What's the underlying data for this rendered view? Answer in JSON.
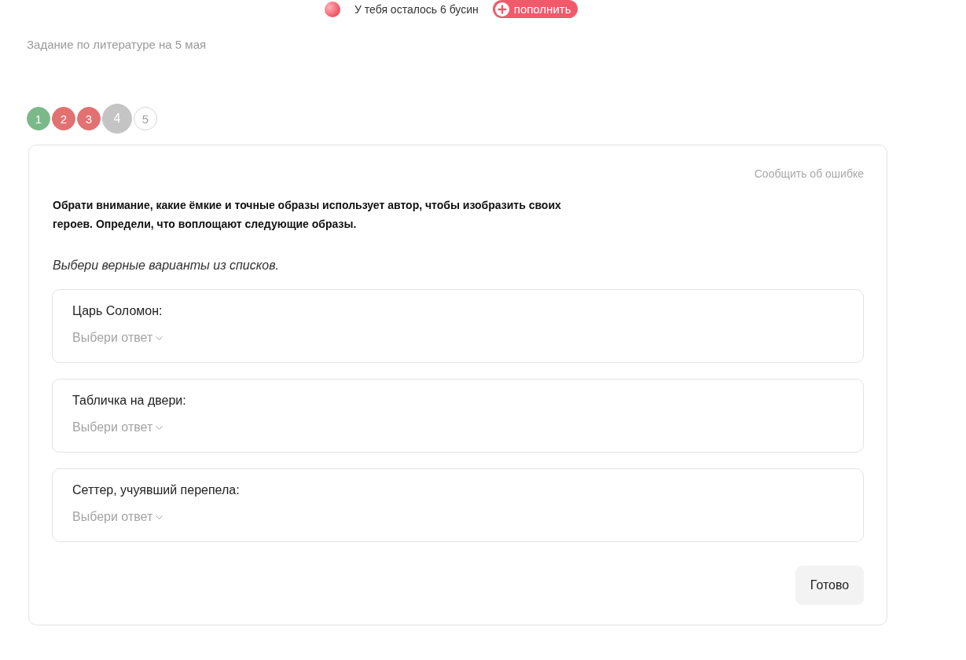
{
  "balance": {
    "text": "У тебя осталось 6 бусин",
    "button": "пополнить"
  },
  "title": "Задание по литературе на 5 мая",
  "steps": [
    {
      "label": "1",
      "kind": "correct",
      "selected": false
    },
    {
      "label": "2",
      "kind": "wrong",
      "selected": false
    },
    {
      "label": "3",
      "kind": "wrong",
      "selected": false
    },
    {
      "label": "4",
      "kind": "open",
      "selected": true
    },
    {
      "label": "5",
      "kind": "open",
      "selected": false
    }
  ],
  "task": {
    "report_link": "Сообщить об ошибке",
    "instruction": "Обрати внимание, какие ёмкие и точные образы использует автор, чтобы изобразить своих героев. Определи, что воплощают следующие образы.",
    "hint": "Выбери верные варианты из списков.",
    "questions": [
      {
        "label": "Царь Соломон:",
        "placeholder": "Выбери ответ"
      },
      {
        "label": "Табличка на двери:",
        "placeholder": "Выбери ответ"
      },
      {
        "label": "Сеттер, учуявший перепела:",
        "placeholder": "Выбери ответ"
      }
    ],
    "submit": "Готово"
  }
}
